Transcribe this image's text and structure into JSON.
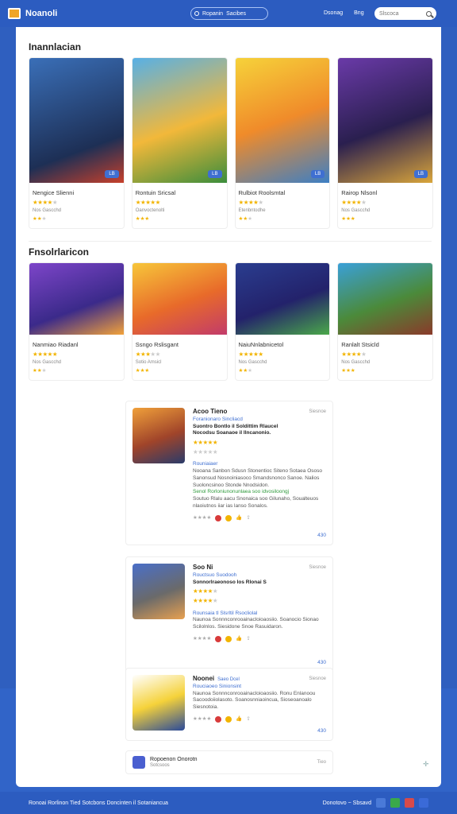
{
  "topbar": {
    "brand": "Noanoli",
    "tabs": [
      "Ropanin",
      "Sacibes"
    ],
    "nav": [
      "Dsonag",
      "Bng"
    ],
    "search_placeholder": "Slscoca"
  },
  "sections": [
    {
      "title": "Inannlacian",
      "cards": [
        {
          "name": "Nengice Slienni",
          "badge": "LB",
          "stars": 4,
          "sub": "Nos Gascchd",
          "stars2": 2
        },
        {
          "name": "Rontuin Sricsal",
          "badge": "LB",
          "stars": 5,
          "sub": "Oanvoctenolti",
          "stars2": 3
        },
        {
          "name": "Rulbiot Roolsmtal",
          "badge": "LB",
          "stars": 4,
          "sub": "Etenbntodhe",
          "stars2": 3
        },
        {
          "name": "Rairop Nlsonl",
          "badge": "LB",
          "stars": 4,
          "sub": "Nos Gascchd",
          "stars2": 3
        }
      ]
    },
    {
      "title": "Fnsolrlaricon",
      "cards": [
        {
          "name": "Nanmiao Riadanl",
          "stars": 5,
          "sub": "Nos Gascchd",
          "stars2": 2
        },
        {
          "name": "Ssngo Rslisgant",
          "stars": 3,
          "sub": "Sotio Amsicl",
          "stars2": 3
        },
        {
          "name": "NaiuNnlabnicetol",
          "stars": 5,
          "sub": "Nos Gascchd",
          "stars2": 2
        },
        {
          "name": "Ranlalt Stsicld",
          "stars": 4,
          "sub": "Nos Gascchd",
          "stars2": 3
        }
      ]
    }
  ],
  "reviews": [
    {
      "title": "Acoo Tieno",
      "date": "Siesnoe",
      "link": "Foranionaro Sincliacd",
      "head": "Suontro Bontlo il Soldittim Rlaucel",
      "head2": "Nocodsu Soanaoe il Ilncanonio.",
      "stars": 5,
      "sec": "Rouniaiaer",
      "body": "Nooana Sanbon Sdusn Stonentioc Siteno Sotaea Ososo Sanonsud Nosnoiniasoco Smandsnonco Sanoe. Nalios Suoloncsinoo Stonde Nnodsidon.",
      "green": "Senol Rorloniunonunlaea soo idvosiloongj",
      "body2": "Soutuo Rlalu aacu Snonaica soo Gilunaho, Soualteuos nlaoiutnos iiar ias lanso Sonalos.",
      "count": "430"
    },
    {
      "title": "Soo Ni",
      "date": "Siesnoe",
      "link": "Rouctsuo Suodooh",
      "head": "Sonnorlraeonoso los Rlonai S",
      "stars": 4,
      "sec": "Rounsaia tl Slsrltil Rsocliolal",
      "body": "Naunoa Sonnnconrooainacloioaosiio. Soanocio Sionao Scilolnlos. Siesidone Snoe Rasuidaron.",
      "count": "430"
    },
    {
      "title": "Noonei",
      "tag": "Saeo Dcel",
      "date": "Siesnoe",
      "link": "Rouciaoeo Sinionsint",
      "body": "Naunoa Sonnnconrooainacloioaosiio. Ronu Enlanoou Sacoodoiiolasoto. Soanosnniaoincua, Sioseoanoalo Siesnotoia.",
      "count": "430"
    }
  ],
  "footer_card": {
    "title": "Ropoenon Onorotn",
    "sub": "Sotcsoos",
    "right": "Tieo"
  },
  "bottombar": {
    "left": "Ronoai Rorlinon Tied Sotcbons Doncinten il Sotaniancua",
    "right": "Donotovo ~ Sbsavd"
  }
}
